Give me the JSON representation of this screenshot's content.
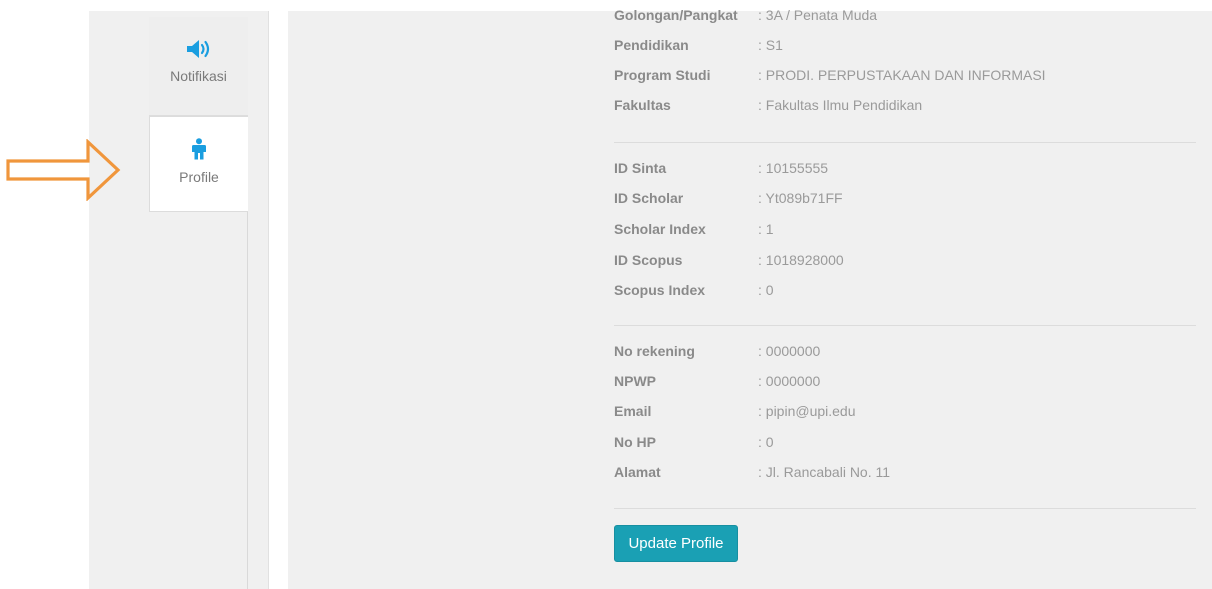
{
  "sidebar": {
    "tabs": [
      {
        "label": "Notifikasi",
        "icon": "speaker-icon"
      },
      {
        "label": "Profile",
        "icon": "person-icon"
      }
    ]
  },
  "profile": {
    "group1": [
      {
        "label": "Golongan/Pangkat",
        "value": ": 3A / Penata Muda"
      },
      {
        "label": "Pendidikan",
        "value": ": S1"
      },
      {
        "label": "Program Studi",
        "value": ": PRODI. PERPUSTAKAAN DAN INFORMASI"
      },
      {
        "label": "Fakultas",
        "value": ": Fakultas Ilmu Pendidikan"
      }
    ],
    "group2": [
      {
        "label": "ID Sinta",
        "value": ": 10155555"
      },
      {
        "label": "ID Scholar",
        "value": ": Yt089b71FF"
      },
      {
        "label": "Scholar Index",
        "value": ": 1"
      },
      {
        "label": "ID Scopus",
        "value": ": 1018928000"
      },
      {
        "label": "Scopus Index",
        "value": ": 0"
      }
    ],
    "group3": [
      {
        "label": "No rekening",
        "value": ": 0000000"
      },
      {
        "label": "NPWP",
        "value": ": 0000000"
      },
      {
        "label": "Email",
        "value": ": pipin@upi.edu"
      },
      {
        "label": "No HP",
        "value": ": 0"
      },
      {
        "label": "Alamat",
        "value": ": Jl. Rancabali No. 11"
      }
    ]
  },
  "actions": {
    "update_label": "Update Profile"
  },
  "colors": {
    "accent": "#1aa0b4",
    "icon": "#1a9ee0",
    "arrow": "#f0963c",
    "panel": "#f0f0f0"
  }
}
